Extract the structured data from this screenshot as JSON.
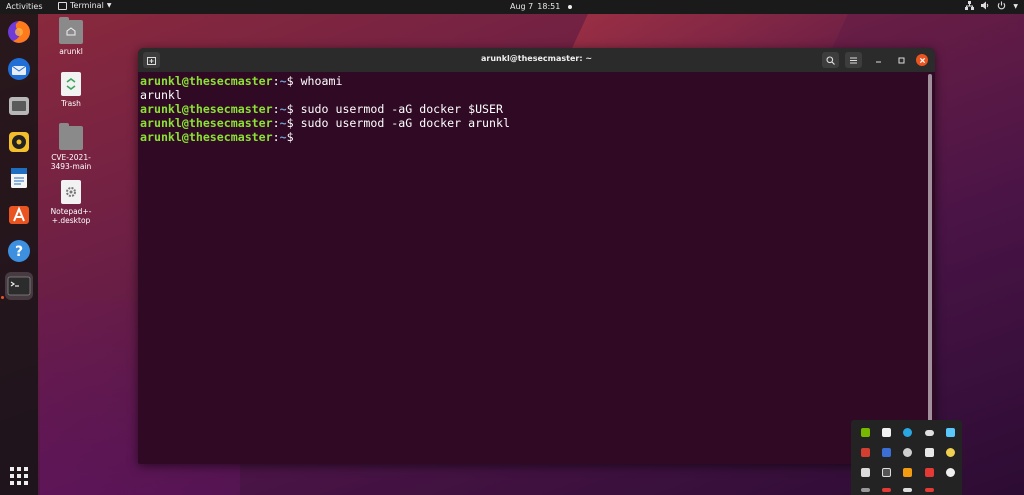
{
  "topbar": {
    "activities": "Activities",
    "app_name": "Terminal",
    "date": "Aug 7",
    "time": "18:51"
  },
  "desktop": {
    "icons": [
      {
        "label": "arunkl"
      },
      {
        "label": "Trash"
      },
      {
        "label": "CVE-2021-3493-main"
      },
      {
        "label": "Notepad+-+.desktop"
      }
    ]
  },
  "dock": {
    "items": [
      "firefox-icon",
      "thunderbird-icon",
      "files-icon",
      "rhythmbox-icon",
      "writer-icon",
      "software-icon",
      "help-icon",
      "terminal-icon"
    ],
    "show_apps": "show-applications-icon"
  },
  "terminal": {
    "title": "arunkl@thesecmaster: ~",
    "prompt_user": "arunkl@thesecmaster",
    "prompt_sep": ":",
    "prompt_path": "~",
    "prompt_symbol": "$ ",
    "lines": [
      {
        "command": "whoami"
      },
      {
        "output": "arunkl"
      },
      {
        "command": "sudo usermod -aG docker $USER"
      },
      {
        "command": "sudo usermod -aG docker arunkl"
      },
      {
        "command": ""
      }
    ]
  },
  "colors": {
    "accent": "#e95420",
    "terminal_bg": "#300a24",
    "prompt_user": "#8ae234",
    "prompt_path": "#729fcf"
  }
}
